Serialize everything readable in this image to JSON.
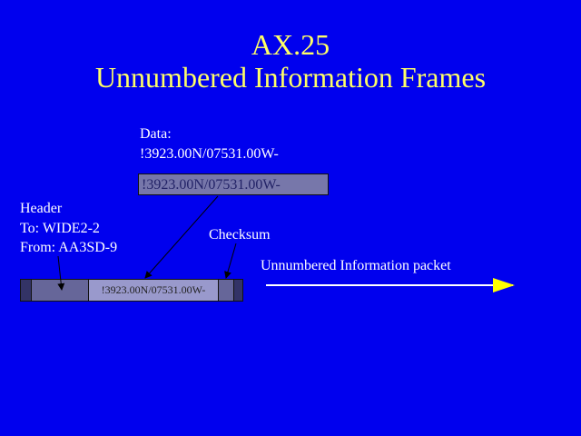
{
  "title_line1": "AX.25",
  "title_line2": "Unnumbered Information Frames",
  "data_label": "Data:",
  "data_value": "!3923.00N/07531.00W-",
  "data_box_text": "!3923.00N/07531.00W-",
  "header_label": "Header",
  "header_to": "To: WIDE2-2",
  "header_from": "From: AA3SD-9",
  "checksum_label": "Checksum",
  "packet_label": "Unnumbered Information packet",
  "frame_info_text": "!3923.00N/07531.00W-",
  "colors": {
    "background": "#0000ee",
    "title": "#ffff66",
    "text": "#ffffff",
    "arrow": "#ffff00"
  }
}
